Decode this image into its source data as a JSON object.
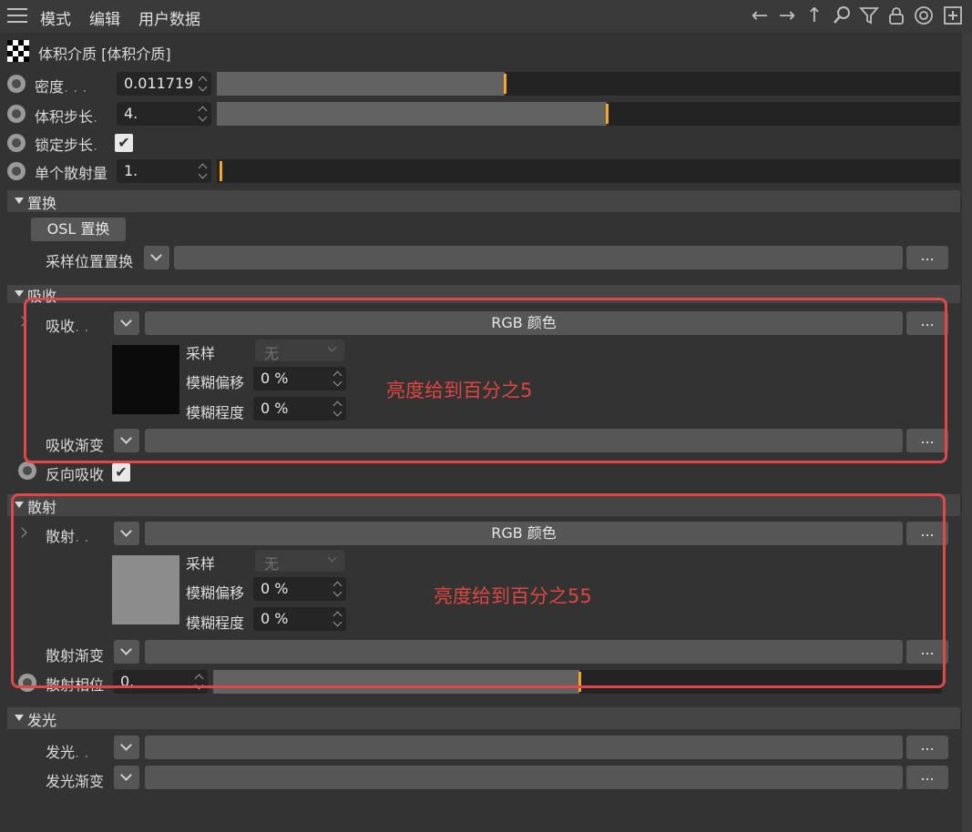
{
  "menubar": {
    "items": [
      "模式",
      "编辑",
      "用户数据"
    ],
    "icons": [
      "arrow-left-icon",
      "arrow-right-icon",
      "arrow-up-icon",
      "search-icon",
      "filter-icon",
      "lock-icon",
      "target-icon",
      "add-icon"
    ]
  },
  "header": {
    "title": "体积介质 [体积介质]"
  },
  "params": {
    "density": {
      "label": "密度",
      "value": "0.011719",
      "slider": 0.39
    },
    "step": {
      "label": "体积步长",
      "value": "4.",
      "slider": 0.53
    },
    "lock_step": {
      "label": "锁定步长"
    },
    "single_scatter": {
      "label": "单个散射量",
      "value": "1.",
      "slider": 0.01
    }
  },
  "displacement": {
    "title": "置换",
    "osl_button": "OSL 置换",
    "sample_pos_label": "采样位置置换",
    "ellipsis": "..."
  },
  "absorption": {
    "title": "吸收",
    "row_label": "吸收",
    "type": "RGB 颜色",
    "swatch_color": "#0b0b0b",
    "sample_label": "采样",
    "sample_value": "无",
    "blur_offset_label": "模糊偏移",
    "blur_offset_value": "0 %",
    "blur_amount_label": "模糊程度",
    "blur_amount_value": "0 %",
    "gradient_label": "吸收渐变",
    "invert_label": "反向吸收",
    "annotation": "亮度给到百分之5"
  },
  "scattering": {
    "title": "散射",
    "row_label": "散射",
    "type": "RGB 颜色",
    "swatch_color": "#8c8c8c",
    "sample_label": "采样",
    "sample_value": "无",
    "blur_offset_label": "模糊偏移",
    "blur_offset_value": "0 %",
    "blur_amount_label": "模糊程度",
    "blur_amount_value": "0 %",
    "gradient_label": "散射渐变",
    "phase_label": "散射相位",
    "phase_value": "0.",
    "phase_slider": 0.5,
    "annotation": "亮度给到百分之55"
  },
  "emission": {
    "title": "发光",
    "row_label": "发光",
    "gradient_label": "发光渐变"
  },
  "colors": {
    "accent": "#f5a623",
    "annotation_red": "#e04848"
  }
}
